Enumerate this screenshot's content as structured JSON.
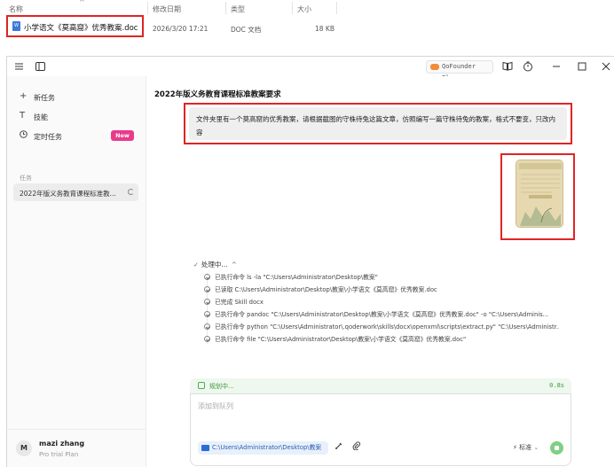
{
  "explorer": {
    "columns": [
      "名称",
      "修改日期",
      "类型",
      "大小"
    ],
    "file": {
      "name": "小学语文《莫高窟》优秀教案.doc",
      "modified": "2026/3/20 17:21",
      "type": "DOC 文档",
      "size": "18 KB"
    }
  },
  "titlebar": {
    "plan_label": "QoFounder Plan"
  },
  "sidebar": {
    "items": [
      {
        "label": "新任务",
        "icon": "plus-icon"
      },
      {
        "label": "技能",
        "icon": "skill-icon"
      },
      {
        "label": "定时任务",
        "icon": "clock-icon",
        "badge": "New"
      }
    ],
    "section_label": "任务",
    "tasks": [
      {
        "label": "2022年版义务教育课程标准教..."
      }
    ],
    "user": {
      "initial": "M",
      "name": "mazi zhang",
      "plan": "Pro trial Plan"
    }
  },
  "main": {
    "title": "2022年版义务教育课程标准教案要求",
    "user_message": "文件夹里有一个莫高窟的优秀教案，请根据截图的守株待兔这篇文章，仿照编写一篇守株待兔的教案，格式不要变，只改内容",
    "processing_label": "处理中...",
    "steps": [
      "已执行命令  ls -la \"C:\\Users\\Administrator\\Desktop\\教案\"",
      "已读取  C:\\Users\\Administrator\\Desktop\\教案\\小学语文《莫高窟》优秀教案.doc",
      "已完成  Skill  docx",
      "已执行命令  pandoc \"C:\\Users\\Administrator\\Desktop\\教案\\小学语文《莫高窟》优秀教案.doc\" -o \"C:\\Users\\Adminis...",
      "已执行命令  python \"C:\\Users\\Administrator\\.qoderwork\\skills\\docx\\openxml\\scripts\\extract.py\" \"C:\\Users\\Administr...",
      "已执行命令  file \"C:\\Users\\Administrator\\Desktop\\教案\\小学语文《莫高窟》优秀教案.doc\""
    ],
    "planning_label": "规划中...",
    "planning_time": "0.8s",
    "composer": {
      "placeholder": "添加到队列",
      "path": "C:\\Users\\Administrator\\Desktop\\教案",
      "mode": "标准"
    }
  },
  "colors": {
    "highlight_border": "#e02424",
    "new_badge": "#ea3b8a",
    "planning_green": "#3c9a3c",
    "send_button": "#7fcf86"
  }
}
